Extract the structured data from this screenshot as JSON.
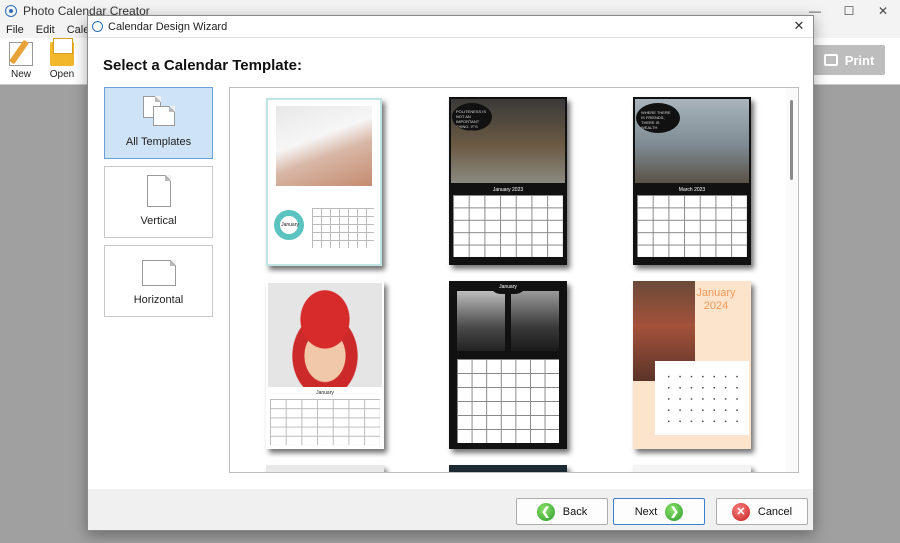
{
  "app": {
    "title": "Photo Calendar Creator",
    "menu": [
      "File",
      "Edit",
      "Calenda"
    ],
    "toolbar": {
      "new_label": "New",
      "open_label": "Open",
      "print_label": "Print"
    },
    "window_controls": {
      "minimize": "—",
      "maximize": "☐",
      "close": "✕"
    }
  },
  "dialog": {
    "title": "Calendar Design Wizard",
    "close_glyph": "✕",
    "heading": "Select a Calendar Template:",
    "categories": [
      {
        "label": "All Templates",
        "selected": true
      },
      {
        "label": "Vertical",
        "selected": false
      },
      {
        "label": "Horizontal",
        "selected": false
      }
    ],
    "templates": [
      {
        "month": "January",
        "caption": "",
        "year": ""
      },
      {
        "month": "January 2023",
        "caption": "POLITENESS IS NOT AN IMPORTANT THING. IT'S EVERYTHING.",
        "year": ""
      },
      {
        "month": "March 2023",
        "caption": "WHERE THERE IS FRIENDS, THERE IS WEALTH",
        "year": ""
      },
      {
        "month": "January",
        "caption": "",
        "year": ""
      },
      {
        "month": "January",
        "caption": "",
        "year": ""
      },
      {
        "month": "January",
        "caption": "",
        "year": "2024"
      }
    ],
    "selected_template_index": 3,
    "buttons": {
      "back": "Back",
      "next": "Next",
      "cancel": "Cancel"
    },
    "colors": {
      "selection": "#0a6fd6",
      "category_active": "#cfe3f7"
    }
  }
}
